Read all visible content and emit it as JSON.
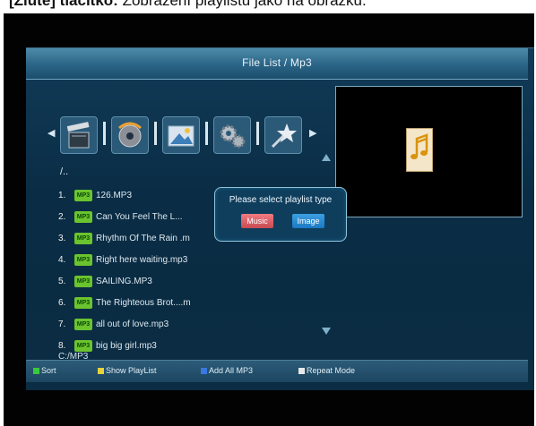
{
  "doc_caption": {
    "bold": "[Žluté] tlačítko:",
    "rest": " Zobrazení playlistu jako na obrázku."
  },
  "window": {
    "title": "File List / Mp3"
  },
  "categories": [
    {
      "icon": "movie-clapper-icon"
    },
    {
      "icon": "music-disc-icon"
    },
    {
      "icon": "picture-icon"
    },
    {
      "icon": "settings-gears-icon"
    },
    {
      "icon": "favourites-star-icon"
    }
  ],
  "file_list": {
    "parent_label": "/..",
    "badge": "MP3",
    "items": [
      {
        "num": "1.",
        "name": "126.MP3"
      },
      {
        "num": "2.",
        "name": "Can You Feel The L..."
      },
      {
        "num": "3.",
        "name": "Rhythm Of The Rain .m"
      },
      {
        "num": "4.",
        "name": "Right here waiting.mp3"
      },
      {
        "num": "5.",
        "name": "SAILING.MP3"
      },
      {
        "num": "6.",
        "name": "The Righteous Brot....m"
      },
      {
        "num": "7.",
        "name": "all out of love.mp3"
      },
      {
        "num": "8.",
        "name": "big big girl.mp3"
      }
    ],
    "current_path": "C:/MP3"
  },
  "preview": {
    "icon": "music-file-icon"
  },
  "dialog": {
    "message": "Please select playlist type",
    "music_label": "Music",
    "image_label": "Image"
  },
  "footer": {
    "sort": {
      "label": "Sort",
      "color": "#3cc83c"
    },
    "show_playlist": {
      "label": "Show PlayList",
      "color": "#e6d23c"
    },
    "add_all": {
      "label": "Add All MP3",
      "color": "#3a78e0"
    },
    "repeat": {
      "label": "Repeat Mode",
      "color": "#e8e8e8"
    }
  }
}
